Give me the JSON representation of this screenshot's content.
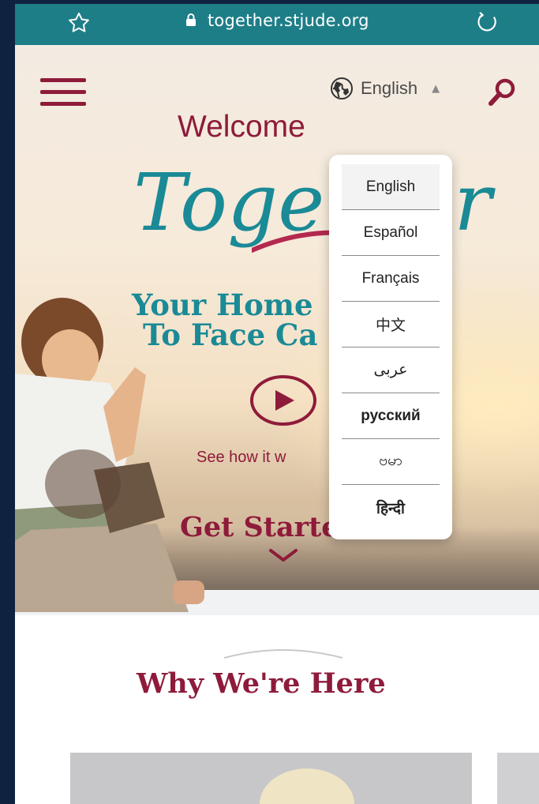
{
  "browser": {
    "url": "together.stjude.org",
    "icons": {
      "favorite": "star-outline-icon",
      "secure": "lock-icon",
      "reload": "reload-icon"
    }
  },
  "header": {
    "language_label": "English",
    "icons": {
      "menu": "hamburger-menu-icon",
      "language": "globe-icon",
      "caret": "caret-up-icon",
      "search": "search-icon"
    }
  },
  "hero": {
    "welcome": "Welcome",
    "logo_text": "Together",
    "tagline_line1": "Your Home",
    "tagline_line2": "To Face Ca",
    "video_link": "See how it w",
    "cta": "Get Started",
    "icons": {
      "play": "play-icon",
      "chevron": "chevron-down-icon"
    }
  },
  "language_menu": {
    "items": [
      {
        "label": "English",
        "selected": true
      },
      {
        "label": "Español"
      },
      {
        "label": "Français"
      },
      {
        "label": "中文"
      },
      {
        "label": "عربى"
      },
      {
        "label": "русский"
      },
      {
        "label": "ဗမာ"
      },
      {
        "label": "हिन्दी"
      }
    ]
  },
  "why_section": {
    "title": "Why We're Here"
  },
  "colors": {
    "brand_maroon": "#8e1b3a",
    "brand_teal": "#1a8a96",
    "urlbar": "#1e7e88",
    "backdrop": "#0f2340"
  }
}
